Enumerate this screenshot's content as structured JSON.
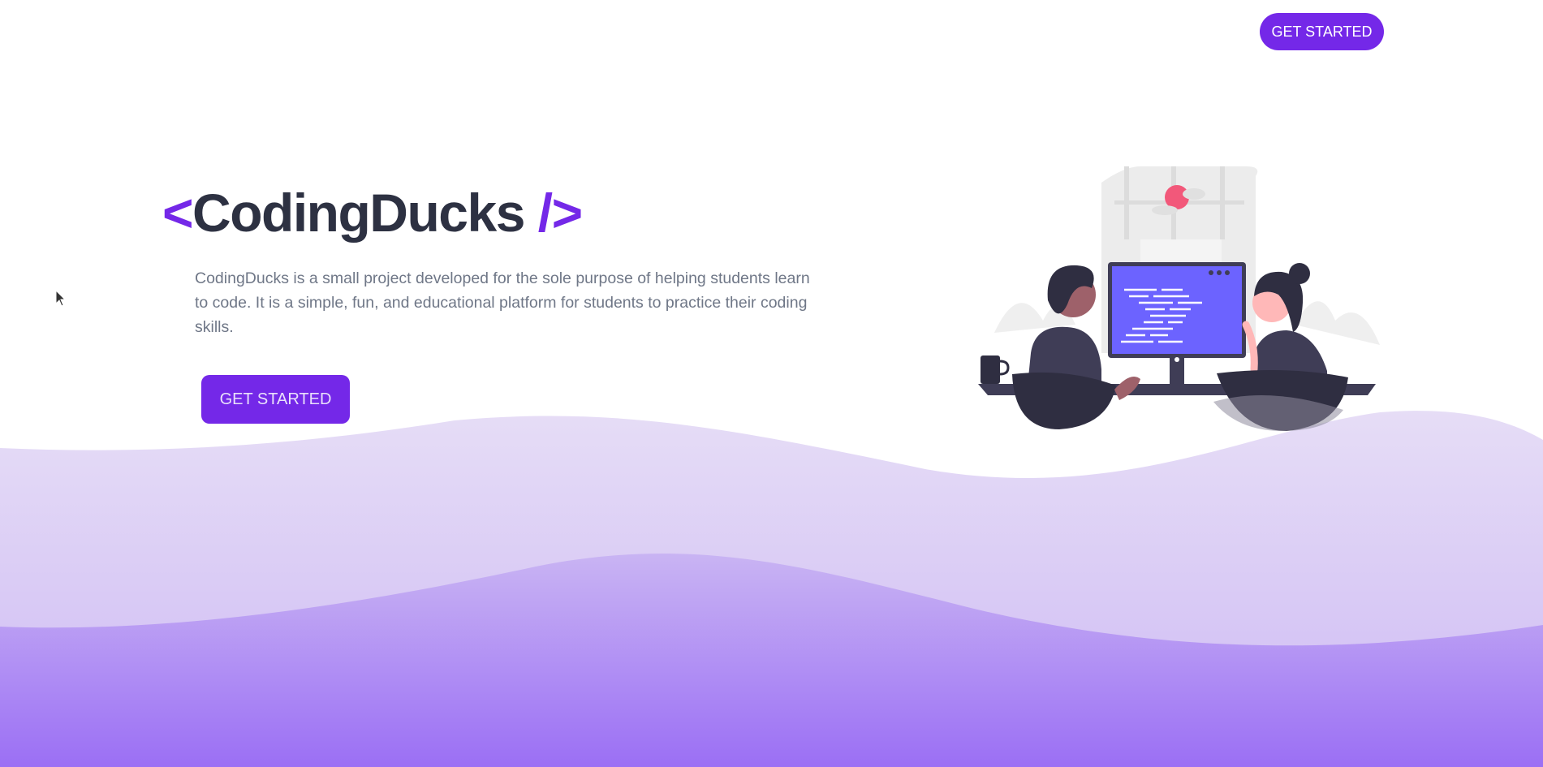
{
  "nav": {
    "cta_label": "GET STARTED"
  },
  "hero": {
    "bracket_open": "<",
    "brand": "CodingDucks",
    "bracket_close": "/>",
    "description": "CodingDucks is a small project developed for the sole purpose of helping students learn to code. It is a simple, fun, and educational platform for students to practice their coding skills.",
    "cta_label": "GET STARTED"
  },
  "illustration": {
    "icon": "two-people-coding-illustration"
  },
  "colors": {
    "accent": "#7428e8",
    "title": "#2d3142",
    "body_text": "#6f7787",
    "wave_light": "#e4dbf6",
    "wave_mid": "#cdb8f5",
    "wave_dark": "#9a72f3",
    "monitor_screen": "#6c63ff"
  }
}
